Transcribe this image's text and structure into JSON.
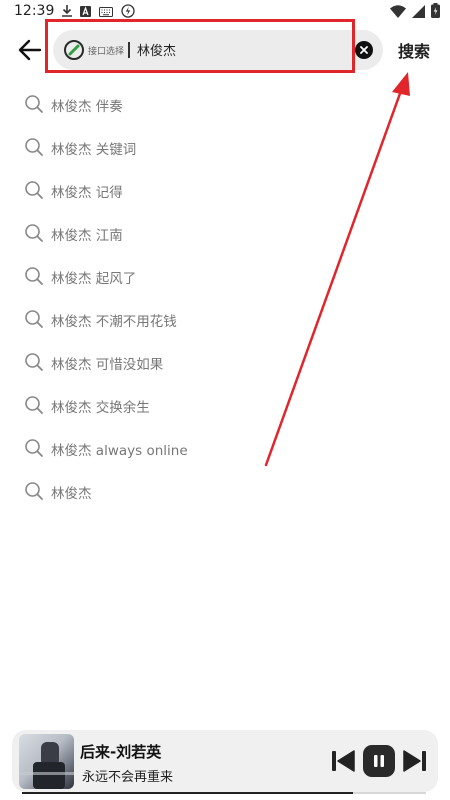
{
  "status_bar": {
    "time": "12:39"
  },
  "header": {
    "api_chip_label": "接口选择",
    "search_value": "林俊杰",
    "search_button": "搜索"
  },
  "suggestions": [
    {
      "text": "林俊杰 伴奏"
    },
    {
      "text": "林俊杰 关键词"
    },
    {
      "text": "林俊杰 记得"
    },
    {
      "text": "林俊杰 江南"
    },
    {
      "text": "林俊杰 起风了"
    },
    {
      "text": "林俊杰 不潮不用花钱"
    },
    {
      "text": "林俊杰 可惜没如果"
    },
    {
      "text": "林俊杰 交换余生"
    },
    {
      "text": "林俊杰 always online"
    },
    {
      "text": "林俊杰"
    }
  ],
  "player": {
    "title": "后来-刘若英",
    "subtitle": "永远不会再重来",
    "progress": 0.82
  },
  "colors": {
    "annotation_red": "#e0262b",
    "accent_green": "#2e9e3e"
  }
}
